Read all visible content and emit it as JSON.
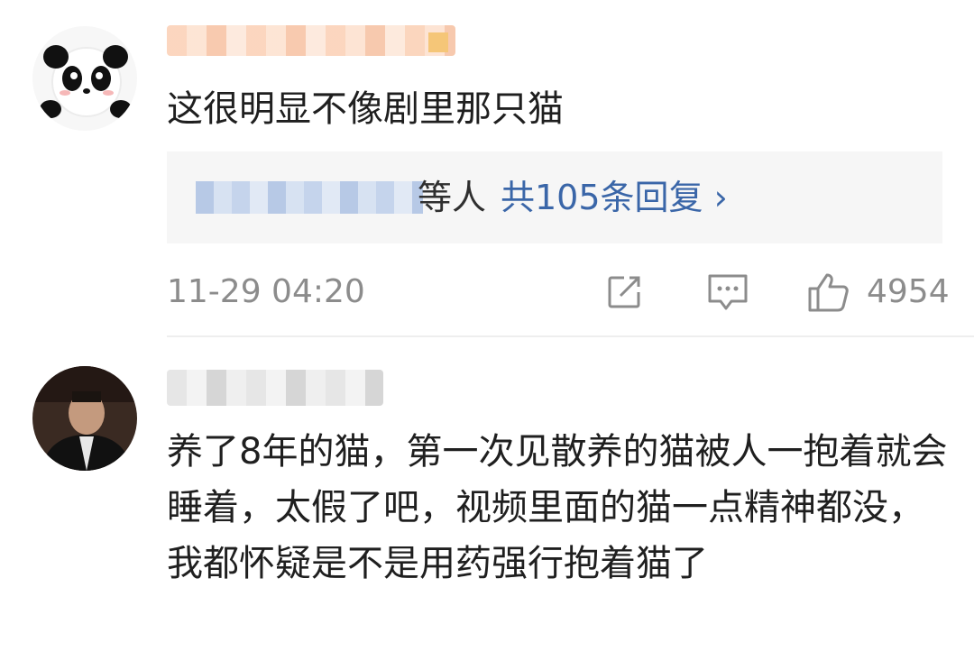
{
  "comments": [
    {
      "text": "这很明显不像剧里那只猫",
      "replies": {
        "suffix": "等人",
        "count_label": "共105条回复 ›"
      },
      "timestamp": "11-29 04:20",
      "like_count": "4954"
    },
    {
      "text": "养了8年的猫，第一次见散养的猫被人一抱着就会睡着，太假了吧，视频里面的猫一点精神都没，我都怀疑是不是用药强行抱着猫了"
    }
  ],
  "colors": {
    "link": "#3a66a8",
    "meta": "#8c8c8c",
    "text": "#1f1f1f",
    "reply_box_bg": "#f6f6f6"
  },
  "icons": [
    "share-icon",
    "reply-icon",
    "like-icon"
  ]
}
